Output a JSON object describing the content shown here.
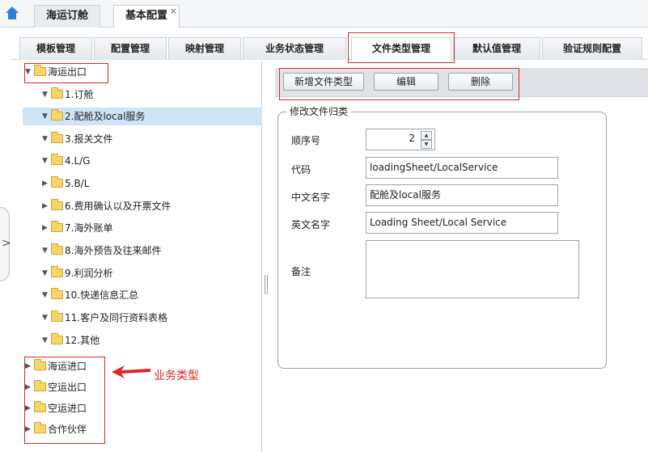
{
  "top_tabs": [
    {
      "label": "海运订舱"
    },
    {
      "label": "基本配置",
      "close": "×"
    }
  ],
  "sub_tabs": [
    "模板管理",
    "配置管理",
    "映射管理",
    "业务状态管理",
    "文件类型管理",
    "默认值管理",
    "验证规则配置"
  ],
  "tree": {
    "root": "海运出口",
    "children": [
      "1.订舱",
      "2.配舱及local服务",
      "3.报关文件",
      "4.L/G",
      "5.B/L",
      "6.费用确认以及开票文件",
      "7.海外账单",
      "8.海外预告及往来邮件",
      "9.利润分析",
      "10.快递信息汇总",
      "11.客户及同行资料表格",
      "12.其他"
    ],
    "business_types": [
      "海运进口",
      "空运出口",
      "空运进口",
      "合作伙伴"
    ]
  },
  "toolbar": {
    "add": "新增文件类型",
    "edit": "编辑",
    "delete": "删除"
  },
  "form": {
    "legend": "修改文件归类",
    "order_label": "顺序号",
    "order_value": "2",
    "code_label": "代码",
    "code_value": "loadingSheet/LocalService",
    "cn_label": "中文名字",
    "cn_value": "配舱及local服务",
    "en_label": "英文名字",
    "en_value": "Loading Sheet/Local Service",
    "remark_label": "备注",
    "remark_value": ""
  },
  "annotation": "业务类型",
  "colors": {
    "highlight_red": "#e0252a",
    "selected_row": "#cfe4f7",
    "home_icon": "#2f7fd6",
    "folder": "#f6d66b"
  }
}
